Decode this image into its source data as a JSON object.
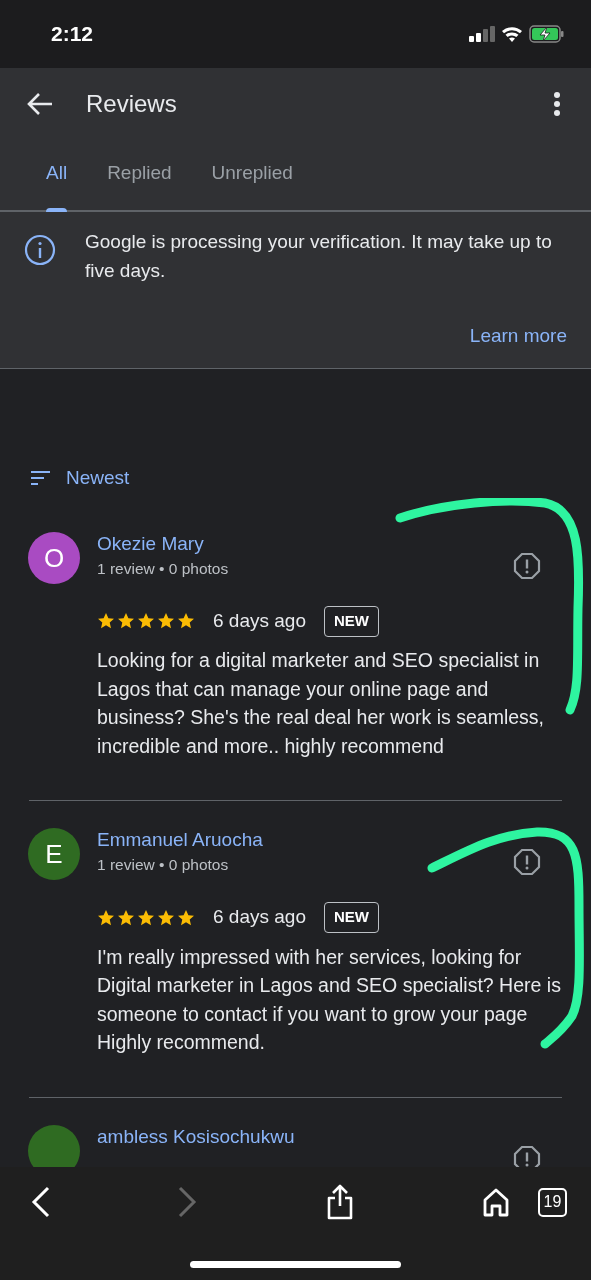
{
  "status_bar": {
    "time": "2:12"
  },
  "header": {
    "title": "Reviews"
  },
  "tabs": [
    {
      "label": "All",
      "selected": true
    },
    {
      "label": "Replied",
      "selected": false
    },
    {
      "label": "Unreplied",
      "selected": false
    }
  ],
  "banner": {
    "message": "Google is processing your verification. It may take up to five days.",
    "link": "Learn more"
  },
  "sort": {
    "label": "Newest"
  },
  "reviews": [
    {
      "avatar_letter": "O",
      "color": "#a94bc2",
      "name": "Okezie Mary",
      "meta": "1 review • 0 photos",
      "stars": 5,
      "time": "6 days ago",
      "badge": "NEW",
      "text": "Looking for a digital marketer and SEO specialist in Lagos that can manage your online page and business? She's the real deal her work is seamless, incredible and more.. highly recommend"
    },
    {
      "avatar_letter": "E",
      "color": "#2f6b22",
      "name": "Emmanuel Aruocha",
      "meta": "1 review • 0 photos",
      "stars": 5,
      "time": "6 days ago",
      "badge": "NEW",
      "text": "I'm really impressed with her services, looking for Digital marketer in Lagos and SEO specialist? Here is someone to contact if you want to grow your page Highly recommend."
    },
    {
      "color": "#2f6b22",
      "name": "ambless Kosisochukwu"
    }
  ],
  "browser_bar": {
    "tab_count": "19"
  }
}
